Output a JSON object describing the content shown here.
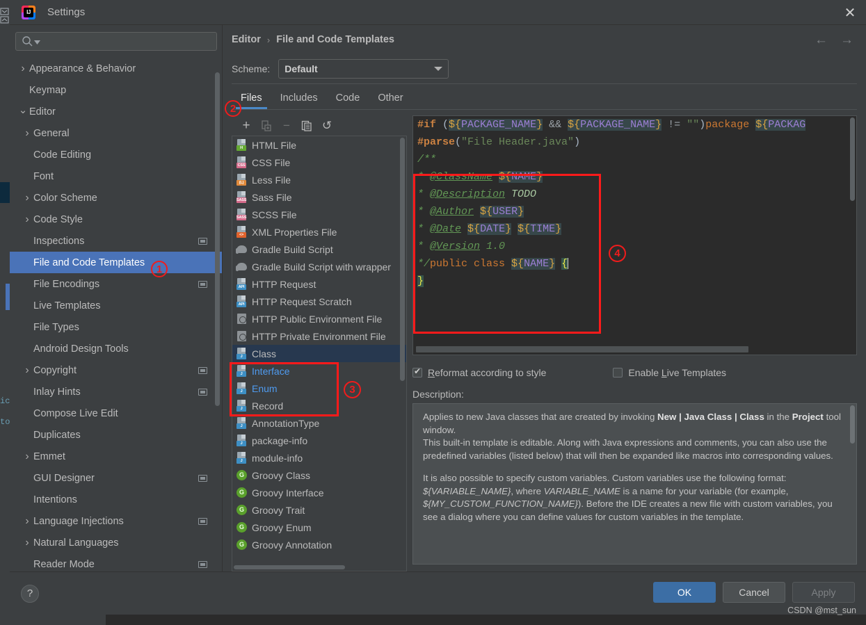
{
  "window": {
    "title": "Settings",
    "logo_text": "IJ",
    "close_icon": "✕"
  },
  "sidebar": {
    "search": {
      "value": "",
      "placeholder": "",
      "icon": "search-icon"
    },
    "items": [
      {
        "label": "Appearance & Behavior",
        "arrow": "collapsed",
        "depth": 0,
        "badge": false,
        "selected": false
      },
      {
        "label": "Keymap",
        "arrow": "none",
        "depth": 0,
        "badge": false,
        "selected": false
      },
      {
        "label": "Editor",
        "arrow": "expanded",
        "depth": 0,
        "badge": false,
        "selected": false
      },
      {
        "label": "General",
        "arrow": "collapsed",
        "depth": 1,
        "badge": false,
        "selected": false
      },
      {
        "label": "Code Editing",
        "arrow": "none",
        "depth": 1,
        "badge": false,
        "selected": false
      },
      {
        "label": "Font",
        "arrow": "none",
        "depth": 1,
        "badge": false,
        "selected": false
      },
      {
        "label": "Color Scheme",
        "arrow": "collapsed",
        "depth": 1,
        "badge": false,
        "selected": false
      },
      {
        "label": "Code Style",
        "arrow": "collapsed",
        "depth": 1,
        "badge": false,
        "selected": false
      },
      {
        "label": "Inspections",
        "arrow": "none",
        "depth": 1,
        "badge": true,
        "selected": false
      },
      {
        "label": "File and Code Templates",
        "arrow": "none",
        "depth": 1,
        "badge": false,
        "selected": true
      },
      {
        "label": "File Encodings",
        "arrow": "none",
        "depth": 1,
        "badge": true,
        "selected": false
      },
      {
        "label": "Live Templates",
        "arrow": "none",
        "depth": 1,
        "badge": false,
        "selected": false
      },
      {
        "label": "File Types",
        "arrow": "none",
        "depth": 1,
        "badge": false,
        "selected": false
      },
      {
        "label": "Android Design Tools",
        "arrow": "none",
        "depth": 1,
        "badge": false,
        "selected": false
      },
      {
        "label": "Copyright",
        "arrow": "collapsed",
        "depth": 1,
        "badge": true,
        "selected": false
      },
      {
        "label": "Inlay Hints",
        "arrow": "none",
        "depth": 1,
        "badge": true,
        "selected": false
      },
      {
        "label": "Compose Live Edit",
        "arrow": "none",
        "depth": 1,
        "badge": false,
        "selected": false
      },
      {
        "label": "Duplicates",
        "arrow": "none",
        "depth": 1,
        "badge": false,
        "selected": false
      },
      {
        "label": "Emmet",
        "arrow": "collapsed",
        "depth": 1,
        "badge": false,
        "selected": false
      },
      {
        "label": "GUI Designer",
        "arrow": "none",
        "depth": 1,
        "badge": true,
        "selected": false
      },
      {
        "label": "Intentions",
        "arrow": "none",
        "depth": 1,
        "badge": false,
        "selected": false
      },
      {
        "label": "Language Injections",
        "arrow": "collapsed",
        "depth": 1,
        "badge": true,
        "selected": false
      },
      {
        "label": "Natural Languages",
        "arrow": "collapsed",
        "depth": 1,
        "badge": false,
        "selected": false
      },
      {
        "label": "Reader Mode",
        "arrow": "none",
        "depth": 1,
        "badge": true,
        "selected": false
      }
    ]
  },
  "breadcrumb": {
    "parent": "Editor",
    "separator": "›",
    "current": "File and Code Templates",
    "back_icon": "←",
    "forward_icon": "→"
  },
  "scheme": {
    "label": "Scheme:",
    "value": "Default"
  },
  "tabs": [
    {
      "label": "Files",
      "active": true
    },
    {
      "label": "Includes",
      "active": false
    },
    {
      "label": "Code",
      "active": false
    },
    {
      "label": "Other",
      "active": false
    }
  ],
  "filelist": {
    "toolbar": [
      {
        "name": "add-button",
        "glyph": "+",
        "disabled": false
      },
      {
        "name": "create-child-template-button",
        "glyph": "copy-add-icon",
        "disabled": true
      },
      {
        "name": "remove-button",
        "glyph": "−",
        "disabled": true
      },
      {
        "name": "copy-button",
        "glyph": "copy-icon",
        "disabled": false
      },
      {
        "name": "reset-button",
        "glyph": "↺",
        "disabled": false
      }
    ],
    "items": [
      {
        "label": "HTML File",
        "icon": "file-html-icon",
        "tag": "H",
        "tagColor": "#64a832",
        "selected": false,
        "blue": false
      },
      {
        "label": "CSS File",
        "icon": "file-css-icon",
        "tag": "CSS",
        "tagColor": "#d46a8a",
        "selected": false,
        "blue": false
      },
      {
        "label": "Less File",
        "icon": "file-less-icon",
        "tag": "(L)",
        "tagColor": "#e08a3c",
        "selected": false,
        "blue": false
      },
      {
        "label": "Sass File",
        "icon": "file-sass-icon",
        "tag": "SASS",
        "tagColor": "#d46a8a",
        "selected": false,
        "blue": false
      },
      {
        "label": "SCSS File",
        "icon": "file-scss-icon",
        "tag": "SASS",
        "tagColor": "#d46a8a",
        "selected": false,
        "blue": false
      },
      {
        "label": "XML Properties File",
        "icon": "file-xml-icon",
        "tag": "<>",
        "tagColor": "#e0622c",
        "selected": false,
        "blue": false
      },
      {
        "label": "Gradle Build Script",
        "icon": "gradle-icon",
        "tag": "",
        "tagColor": "",
        "selected": false,
        "blue": false
      },
      {
        "label": "Gradle Build Script with wrapper",
        "icon": "gradle-icon",
        "tag": "",
        "tagColor": "",
        "selected": false,
        "blue": false
      },
      {
        "label": "HTTP Request",
        "icon": "file-http-icon",
        "tag": "API",
        "tagColor": "#3d8fc4",
        "selected": false,
        "blue": false
      },
      {
        "label": "HTTP Request Scratch",
        "icon": "file-http-icon",
        "tag": "API",
        "tagColor": "#3d8fc4",
        "selected": false,
        "blue": false
      },
      {
        "label": "HTTP Public Environment File",
        "icon": "http-env-icon",
        "tag": "",
        "tagColor": "",
        "selected": false,
        "blue": false
      },
      {
        "label": "HTTP Private Environment File",
        "icon": "http-env-icon",
        "tag": "",
        "tagColor": "",
        "selected": false,
        "blue": false
      },
      {
        "label": "Class",
        "icon": "file-java-icon",
        "tag": "J",
        "tagColor": "#3d8fc4",
        "selected": true,
        "blue": false
      },
      {
        "label": "Interface",
        "icon": "file-java-icon",
        "tag": "J",
        "tagColor": "#3d8fc4",
        "selected": false,
        "blue": true
      },
      {
        "label": "Enum",
        "icon": "file-java-icon",
        "tag": "J",
        "tagColor": "#3d8fc4",
        "selected": false,
        "blue": true
      },
      {
        "label": "Record",
        "icon": "file-java-icon",
        "tag": "J",
        "tagColor": "#3d8fc4",
        "selected": false,
        "blue": false
      },
      {
        "label": "AnnotationType",
        "icon": "file-java-icon",
        "tag": "J",
        "tagColor": "#3d8fc4",
        "selected": false,
        "blue": false
      },
      {
        "label": "package-info",
        "icon": "file-java-icon",
        "tag": "J",
        "tagColor": "#3d8fc4",
        "selected": false,
        "blue": false
      },
      {
        "label": "module-info",
        "icon": "file-java-icon",
        "tag": "J",
        "tagColor": "#3d8fc4",
        "selected": false,
        "blue": false
      },
      {
        "label": "Groovy Class",
        "icon": "groovy-icon",
        "tag": "G",
        "tagColor": "#5aa02c",
        "selected": false,
        "blue": false
      },
      {
        "label": "Groovy Interface",
        "icon": "groovy-icon",
        "tag": "G",
        "tagColor": "#5aa02c",
        "selected": false,
        "blue": false
      },
      {
        "label": "Groovy Trait",
        "icon": "groovy-icon",
        "tag": "G",
        "tagColor": "#5aa02c",
        "selected": false,
        "blue": false
      },
      {
        "label": "Groovy Enum",
        "icon": "groovy-icon",
        "tag": "G",
        "tagColor": "#5aa02c",
        "selected": false,
        "blue": false
      },
      {
        "label": "Groovy Annotation",
        "icon": "groovy-icon",
        "tag": "G",
        "tagColor": "#5aa02c",
        "selected": false,
        "blue": false
      }
    ]
  },
  "editor": {
    "lines": [
      "#if (${PACKAGE_NAME} && ${PACKAGE_NAME} != \"\")package ${PACKAG",
      "#parse(\"File Header.java\")",
      "/**",
      " * @ClassName ${NAME}",
      " * @Description TODO",
      " * @Author ${USER}",
      " * @Date ${DATE} ${TIME}",
      " * @Version 1.0",
      " */public class ${NAME} {",
      "}"
    ]
  },
  "options": {
    "reformat": {
      "label": "Reformat according to style",
      "checked": true
    },
    "live_templates": {
      "label": "Enable Live Templates",
      "checked": false
    }
  },
  "description": {
    "label": "Description:",
    "p1_a": "Applies to new Java classes that are created by invoking ",
    "p1_b": "New | Java Class | Class",
    "p1_c": " in the ",
    "p1_d": "Project",
    "p1_e": " tool window.",
    "p2": "This built-in template is editable. Along with Java expressions and comments, you can also use the predefined variables (listed below) that will then be expanded like macros into corresponding values.",
    "p3_a": "It is also possible to specify custom variables. Custom variables use the following format: ",
    "p3_b": "${VARIABLE_NAME}",
    "p3_c": ", where ",
    "p3_d": "VARIABLE_NAME",
    "p3_e": " is a name for your variable (for example, ",
    "p3_f": "${MY_CUSTOM_FUNCTION_NAME}",
    "p3_g": "). Before the IDE creates a new file with custom variables, you see a dialog where you can define values for custom variables in the template."
  },
  "footer": {
    "help": "?",
    "ok": "OK",
    "cancel": "Cancel",
    "apply": "Apply",
    "watermark": "CSDN @mst_sun"
  },
  "annotations": [
    {
      "id": "1",
      "target": "sidebar-item-file-and-code-templates"
    },
    {
      "id": "2",
      "target": "tab-files"
    },
    {
      "id": "3",
      "target": "filelist-java-group"
    },
    {
      "id": "4",
      "target": "editor-template-block"
    }
  ],
  "colors": {
    "accent": "#4a73b8",
    "annotation": "#ff1a1a",
    "selection": "#27384f",
    "panel": "#3c3f41",
    "editor_bg": "#2b2b2b"
  }
}
